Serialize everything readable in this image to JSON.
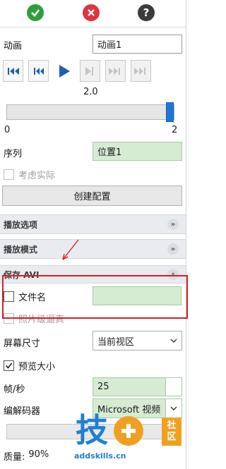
{
  "toolbar": {
    "ok_icon": "check-icon",
    "cancel_icon": "x-icon",
    "help_icon": "help-icon",
    "help_glyph": "?"
  },
  "animation": {
    "label": "动画",
    "value": "动画1"
  },
  "playback": {
    "speed": "2.0",
    "slider_min": "0",
    "slider_max": "2",
    "slider_fraction": 1.0
  },
  "sequence": {
    "label": "序列",
    "value": "位置1"
  },
  "consider_actual": {
    "label": "考虑实际"
  },
  "create_config": {
    "label": "创建配置"
  },
  "sections": {
    "play_options": "播放选项",
    "play_mode": "播放模式",
    "save_avi": "保存 AVI"
  },
  "filename": {
    "label": "文件名",
    "value": ""
  },
  "photoreal": {
    "label": "照片级逼真"
  },
  "screen_size": {
    "label": "屏幕尺寸",
    "value": "当前视区"
  },
  "preview_size": {
    "label": "预览大小",
    "checked": true
  },
  "fps": {
    "label": "帧/秒",
    "value": "25"
  },
  "codec": {
    "label": "编解码器",
    "value": "Microsoft 视频"
  },
  "quality": {
    "label": "质量:",
    "value": "90%"
  },
  "watermark": {
    "text_main": "技",
    "text_side1": "社",
    "text_side2": "区",
    "url": "addskills.cn"
  },
  "colors": {
    "ok": "#2f9e3a",
    "cancel": "#e03340",
    "help": "#3b3b3b",
    "accent": "#1d78d6",
    "annotation": "#d81f26"
  }
}
